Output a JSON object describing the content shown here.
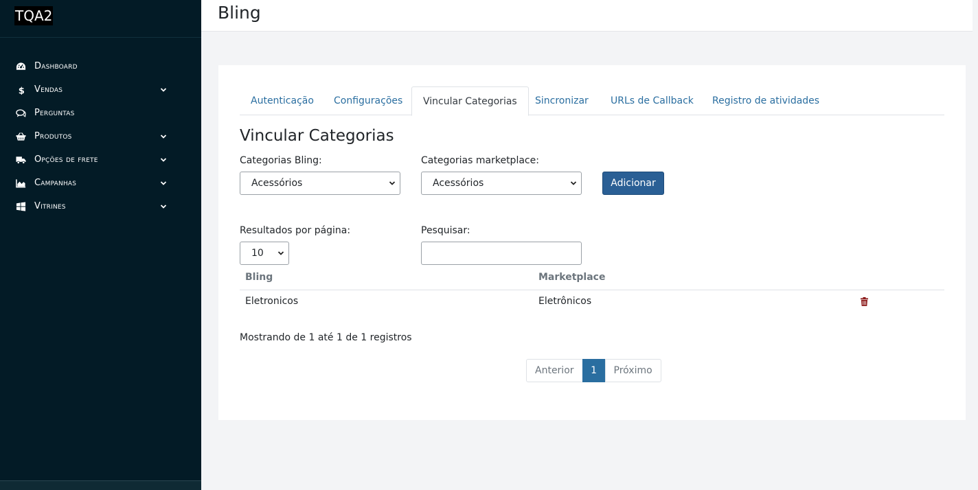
{
  "sidebar": {
    "brand": "TQA2",
    "items": [
      {
        "label": "Dashboard",
        "icon": "dashboard-icon",
        "has_submenu": false
      },
      {
        "label": "Vendas",
        "icon": "dollar-icon",
        "has_submenu": true
      },
      {
        "label": "Perguntas",
        "icon": "comments-icon",
        "has_submenu": false
      },
      {
        "label": "Produtos",
        "icon": "basket-icon",
        "has_submenu": true
      },
      {
        "label": "Opções de frete",
        "icon": "truck-icon",
        "has_submenu": true
      },
      {
        "label": "Campanhas",
        "icon": "area-chart-icon",
        "has_submenu": true
      },
      {
        "label": "Vitrines",
        "icon": "windows-icon",
        "has_submenu": true
      }
    ]
  },
  "header": {
    "title": "Bling"
  },
  "tabs": [
    {
      "label": "Autenticação",
      "active": false
    },
    {
      "label": "Configurações",
      "active": false
    },
    {
      "label": "Vincular Categorias",
      "active": true
    },
    {
      "label": "Sincronizar",
      "active": false
    },
    {
      "label": "URLs de Callback",
      "active": false
    },
    {
      "label": "Registro de atividades",
      "active": false
    }
  ],
  "main": {
    "section_title": "Vincular Categorias",
    "bling_label": "Categorias Bling:",
    "bling_selected": "Acessórios",
    "marketplace_label": "Categorias marketplace:",
    "marketplace_selected": "Acessórios",
    "add_button": "Adicionar",
    "per_page_label": "Resultados por página:",
    "per_page_selected": "10",
    "search_label": "Pesquisar:",
    "search_value": ""
  },
  "table": {
    "columns": [
      "Bling",
      "Marketplace"
    ],
    "rows": [
      {
        "bling": "Eletronicos",
        "marketplace": "Eletrônicos"
      }
    ]
  },
  "footer": {
    "info": "Mostrando de 1 até 1 de 1 registros",
    "prev": "Anterior",
    "current_page": "1",
    "next": "Próximo"
  },
  "colors": {
    "sidebar_bg": "#031b26",
    "primary": "#2a5f95",
    "link": "#2a6ea0",
    "danger": "#8b1a1a"
  }
}
